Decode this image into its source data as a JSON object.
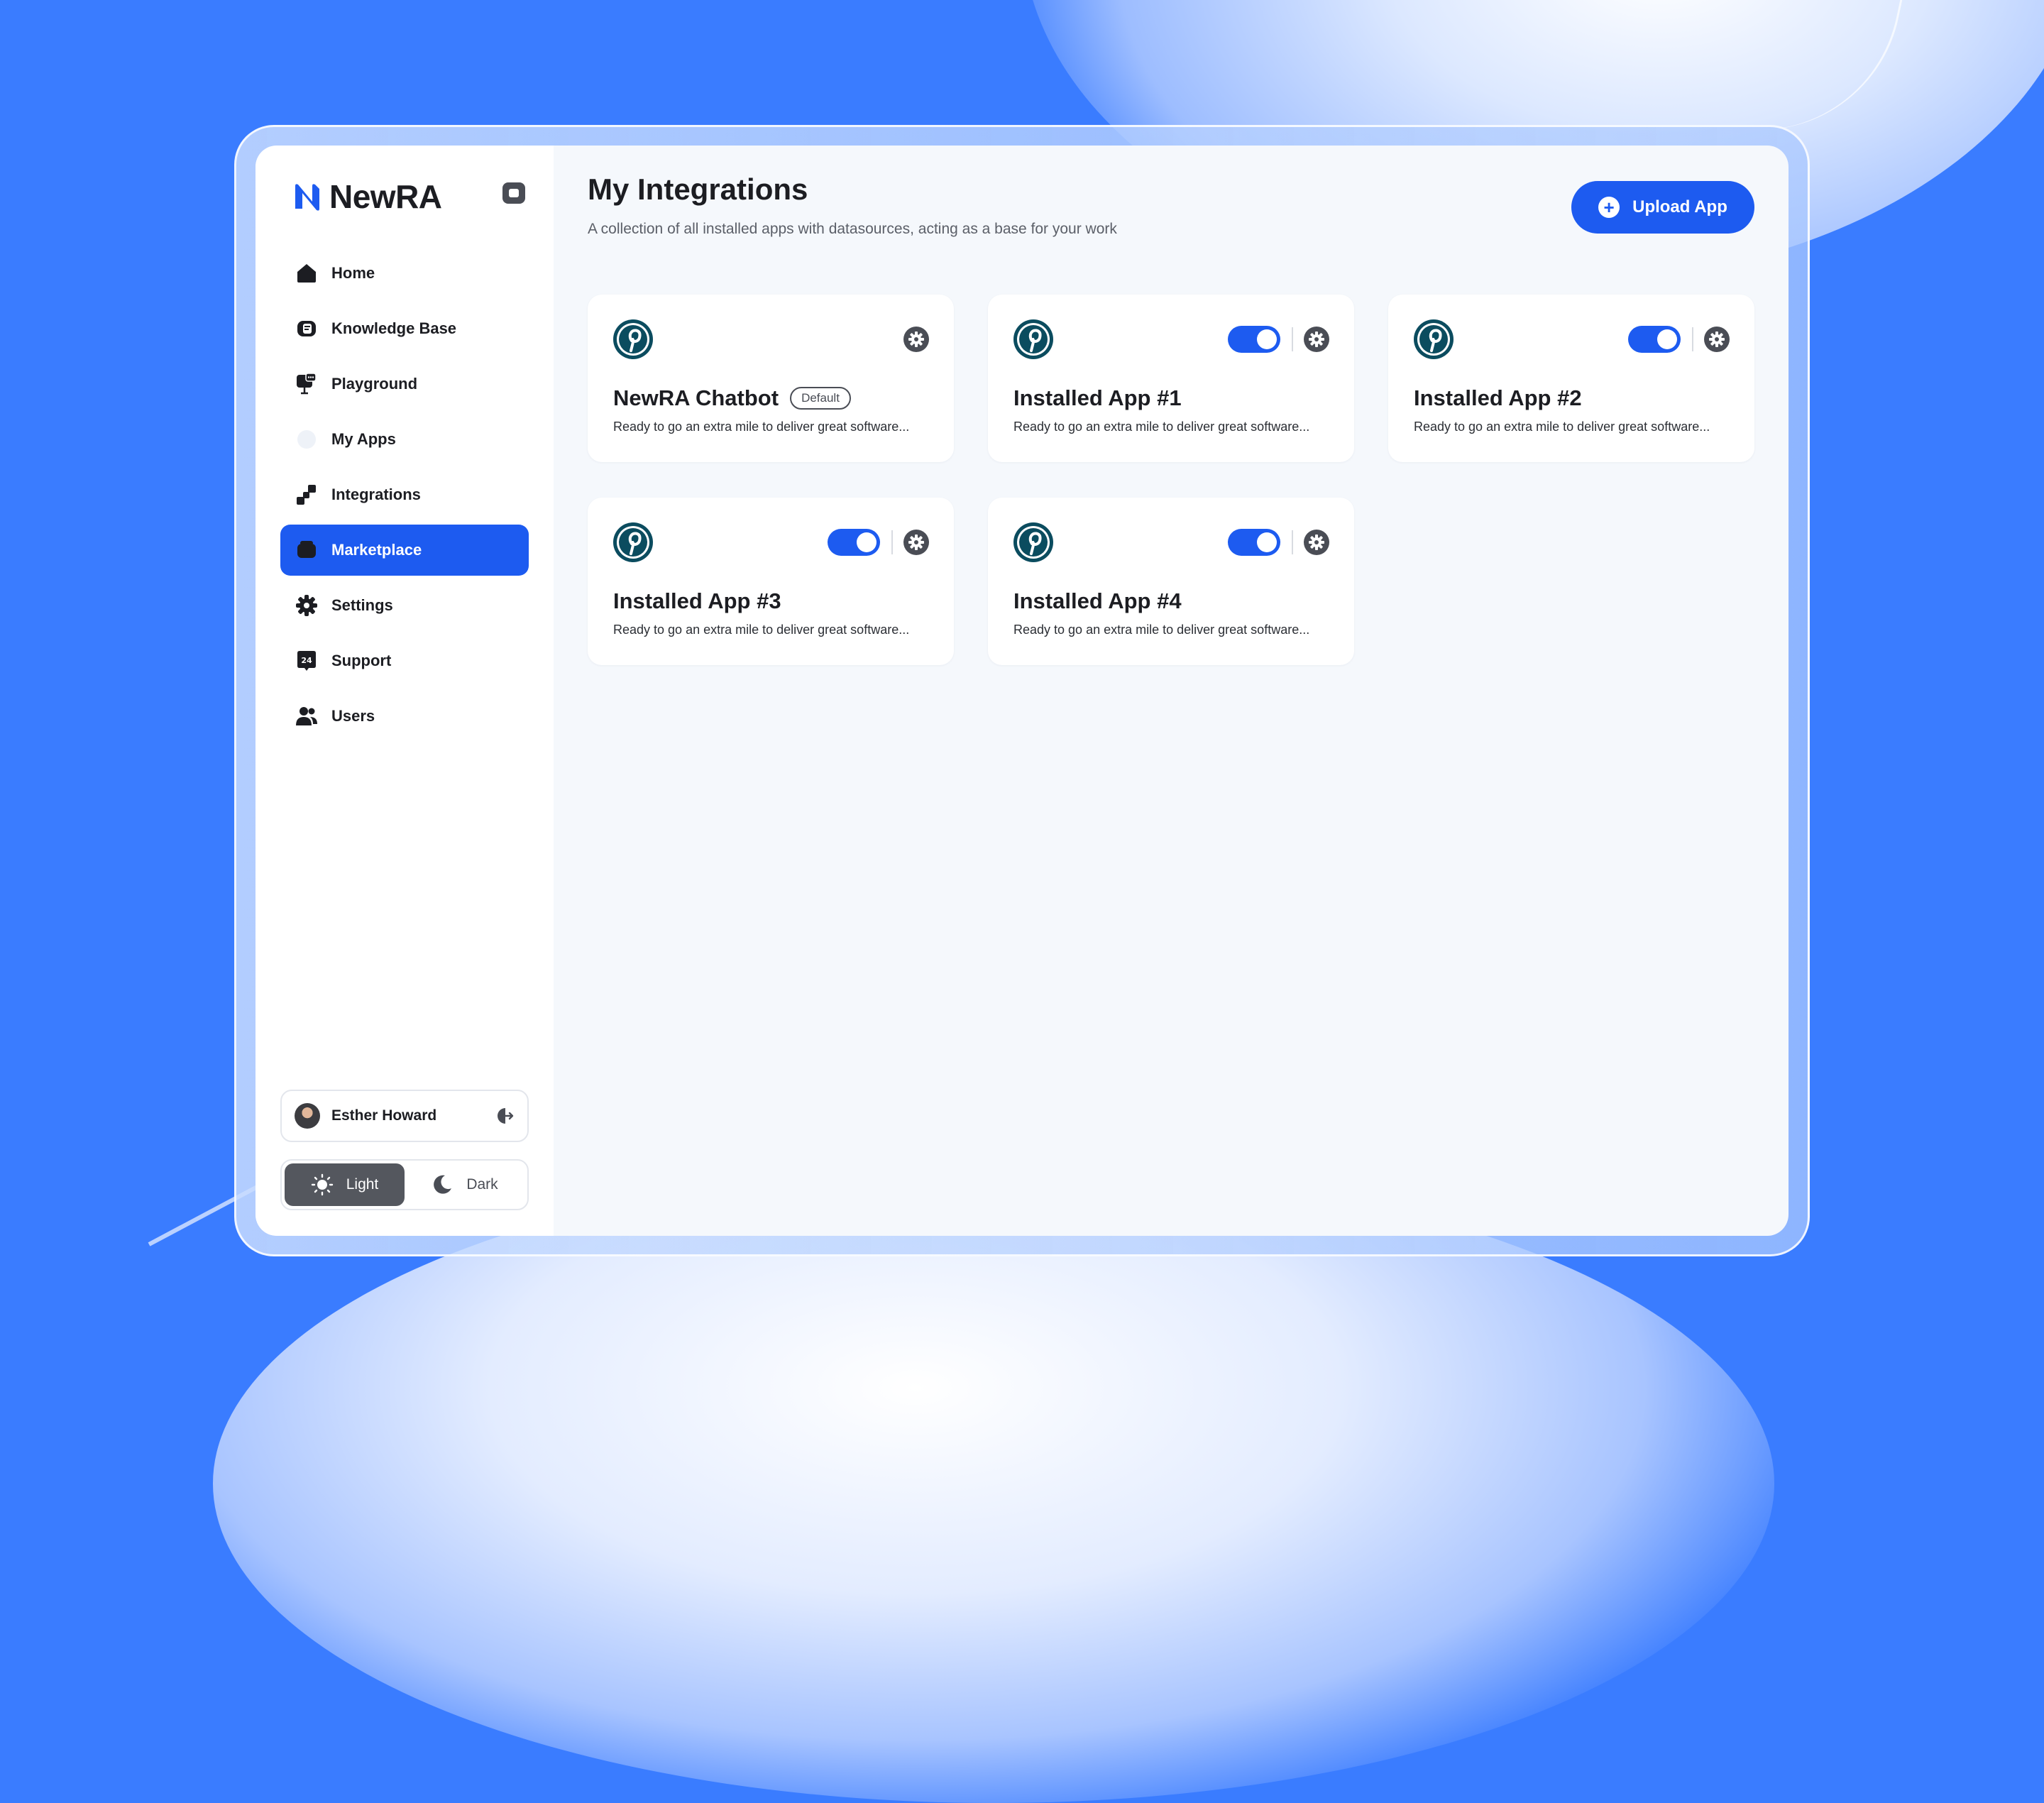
{
  "brand": {
    "name": "NewRA"
  },
  "sidebar": {
    "items": [
      {
        "label": "Home",
        "icon": "home-icon",
        "active": false
      },
      {
        "label": "Knowledge Base",
        "icon": "knowledge-base-icon",
        "active": false
      },
      {
        "label": "Playground",
        "icon": "playground-icon",
        "active": false
      },
      {
        "label": "My Apps",
        "icon": "my-apps-icon",
        "active": false
      },
      {
        "label": "Integrations",
        "icon": "integrations-icon",
        "active": false
      },
      {
        "label": "Marketplace",
        "icon": "marketplace-icon",
        "active": true
      },
      {
        "label": "Settings",
        "icon": "gear-icon",
        "active": false
      },
      {
        "label": "Support",
        "icon": "support-24-icon",
        "active": false
      },
      {
        "label": "Users",
        "icon": "users-icon",
        "active": false
      }
    ],
    "user": {
      "name": "Esther Howard"
    },
    "theme": {
      "light_label": "Light",
      "dark_label": "Dark",
      "selected": "Light"
    }
  },
  "header": {
    "title": "My Integrations",
    "subtitle": "A collection of all installed apps with datasources, acting as a base for your work",
    "upload_label": "Upload App"
  },
  "cards": [
    {
      "name": "NewRA Chatbot",
      "badge": "Default",
      "description": "Ready to go an extra mile to deliver great software...",
      "has_toggle": false,
      "enabled": null
    },
    {
      "name": "Installed App #1",
      "badge": "",
      "description": "Ready to go an extra mile to deliver great software...",
      "has_toggle": true,
      "enabled": true
    },
    {
      "name": "Installed App #2",
      "badge": "",
      "description": "Ready to go an extra mile to deliver great software...",
      "has_toggle": true,
      "enabled": true
    },
    {
      "name": "Installed App #3",
      "badge": "",
      "description": "Ready to go an extra mile to deliver great software...",
      "has_toggle": true,
      "enabled": true
    },
    {
      "name": "Installed App #4",
      "badge": "",
      "description": "Ready to go an extra mile to deliver great software...",
      "has_toggle": true,
      "enabled": true
    }
  ],
  "colors": {
    "accent": "#1d5bf0",
    "background": "#3a7cff",
    "pinterest": "#0b4c5f"
  }
}
